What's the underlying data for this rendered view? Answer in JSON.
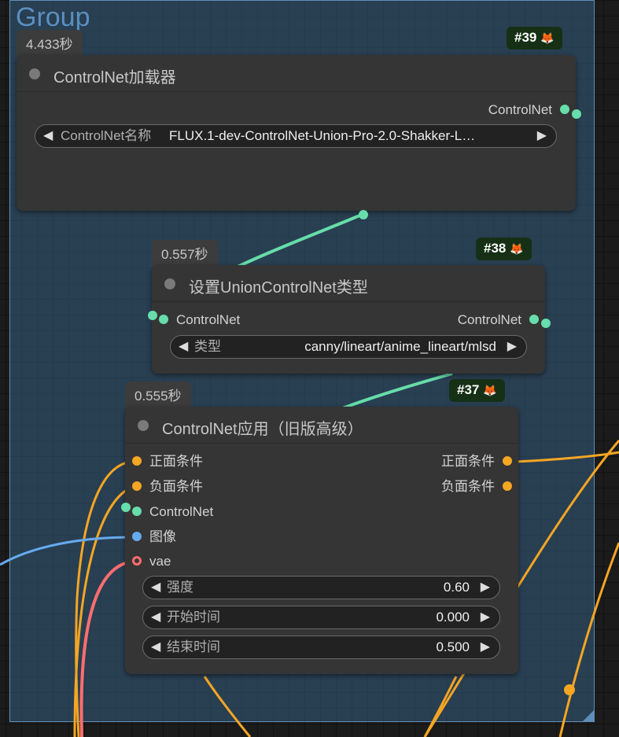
{
  "colors": {
    "conditioning": "#f5a623",
    "controlnet": "#66ddaa",
    "image": "#66aaee",
    "vae": "#ff6e6e"
  },
  "group": {
    "title": "Group"
  },
  "node39": {
    "time": "4.433秒",
    "id": "#39",
    "title": "ControlNet加载器",
    "output_label": "ControlNet",
    "widget_label": "ControlNet名称",
    "widget_value": "FLUX.1-dev-ControlNet-Union-Pro-2.0-Shakker-L…"
  },
  "node38": {
    "time": "0.557秒",
    "id": "#38",
    "title": "设置UnionControlNet类型",
    "input_label": "ControlNet",
    "output_label": "ControlNet",
    "widget_label": "类型",
    "widget_value": "canny/lineart/anime_lineart/mlsd"
  },
  "node37": {
    "time": "0.555秒",
    "id": "#37",
    "title": "ControlNet应用（旧版高级）",
    "inputs": [
      "正面条件",
      "负面条件",
      "ControlNet",
      "图像",
      "vae"
    ],
    "outputs": [
      "正面条件",
      "负面条件"
    ],
    "widgets": [
      {
        "label": "强度",
        "value": "0.60"
      },
      {
        "label": "开始时间",
        "value": "0.000"
      },
      {
        "label": "结束时间",
        "value": "0.500"
      }
    ]
  },
  "icons": {
    "badge": "fox-icon",
    "left_arrow": "arrow-left-icon",
    "right_arrow": "arrow-right-icon"
  }
}
